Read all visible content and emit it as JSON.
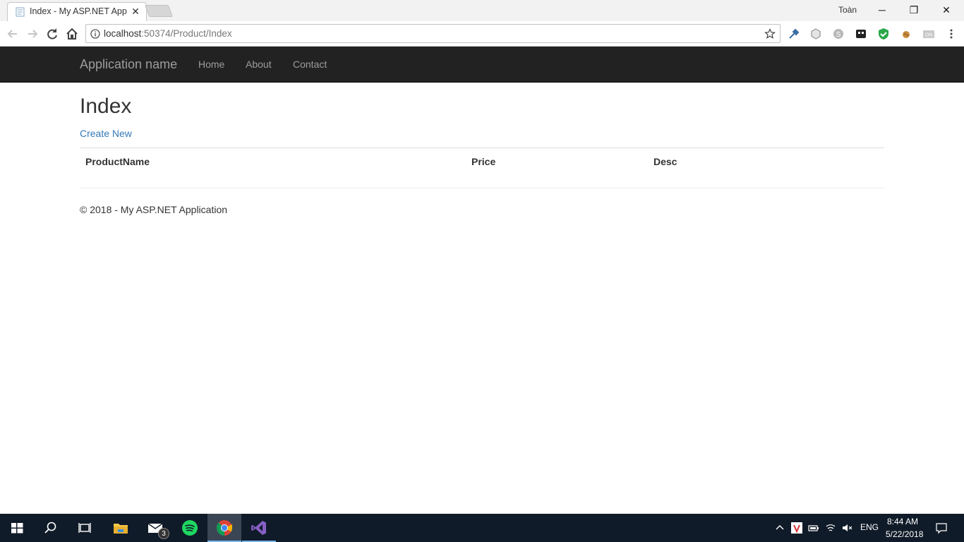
{
  "browser": {
    "tab_title": "Index - My ASP.NET Appl",
    "tab_close": "✕",
    "profile_name": "Toàn",
    "window_controls": {
      "minimize": "─",
      "restore": "❐",
      "close": "✕"
    },
    "url_host": "localhost",
    "url_rest": ":50374/Product/Index"
  },
  "navbar": {
    "brand": "Application name",
    "links": [
      "Home",
      "About",
      "Contact"
    ]
  },
  "page": {
    "title": "Index",
    "create_link": "Create New",
    "columns": [
      "ProductName",
      "Price",
      "Desc"
    ],
    "footer": "© 2018 - My ASP.NET Application"
  },
  "taskbar": {
    "mail_badge": "3",
    "language": "ENG",
    "time": "8:44 AM",
    "date": "5/22/2018"
  },
  "colors": {
    "navbar_bg": "#222222",
    "link": "#337ab7",
    "taskbar_bg": "#101b29"
  }
}
